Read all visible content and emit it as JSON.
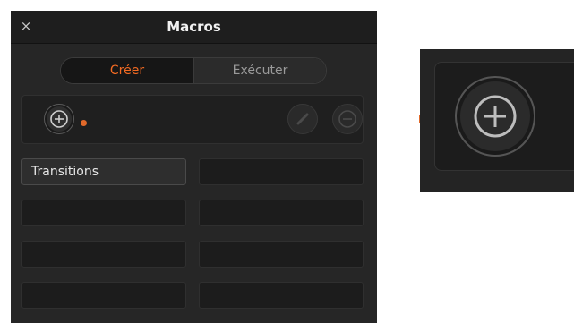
{
  "window": {
    "title": "Macros",
    "close_glyph": "×"
  },
  "tabs": [
    {
      "label": "Créer",
      "active": true
    },
    {
      "label": "Exécuter",
      "active": false
    }
  ],
  "toolbar": {
    "add_icon": "plus-circle-icon",
    "edit_icon": "pencil-icon",
    "delete_icon": "minus-circle-icon"
  },
  "macros": [
    {
      "label": "Transitions"
    },
    {
      "label": ""
    },
    {
      "label": ""
    },
    {
      "label": ""
    },
    {
      "label": ""
    },
    {
      "label": ""
    },
    {
      "label": ""
    },
    {
      "label": ""
    }
  ],
  "colors": {
    "accent": "#f26a22",
    "callout": "#e1692a",
    "panel_bg": "#262626"
  },
  "callout": {
    "icon": "plus-circle-icon"
  }
}
